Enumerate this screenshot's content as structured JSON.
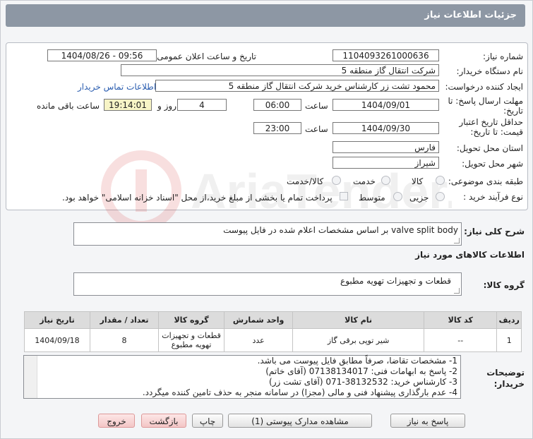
{
  "header": {
    "title": "جزئیات اطلاعات نیاز"
  },
  "form": {
    "need_number_label": "شماره نیاز:",
    "need_number": "1104093261000636",
    "announce_label": "تاریخ و ساعت اعلان عمومی:",
    "announce_value": "1404/08/26 - 09:56",
    "buyer_org_label": "نام دستگاه خریدار:",
    "buyer_org": "شرکت انتقال گاز منطقه 5",
    "creator_label": "ایجاد کننده درخواست:",
    "creator": "محمود تشت زر کارشناس خرید شرکت انتقال گاز منطقه 5",
    "contact_link": "اطلاعات تماس خریدار",
    "deadline_label": "مهلت ارسال پاسخ: تا تاریخ:",
    "deadline_date": "1404/09/01",
    "time_label": "ساعت",
    "deadline_time": "06:00",
    "days_value": "4",
    "days_label": "روز و",
    "remaining_time": "19:14:01",
    "remaining_label": "ساعت باقی مانده",
    "validity_label": "حداقل تاریخ اعتبار قیمت: تا تاریخ:",
    "validity_date": "1404/09/30",
    "validity_time": "23:00",
    "province_label": "استان محل تحویل:",
    "province": "فارس",
    "city_label": "شهر محل تحویل:",
    "city": "شیراز",
    "category_label": "طبقه بندی موضوعی:",
    "category_options": [
      "کالا",
      "خدمت",
      "کالا/خدمت"
    ],
    "process_label": "نوع فرآیند خرید :",
    "process_options": [
      "جزیی",
      "متوسط"
    ],
    "payment_note": "پرداخت تمام یا بخشی از مبلغ خرید،از محل \"اسناد خزانه اسلامی\" خواهد بود."
  },
  "description": {
    "label": "شرح کلی نیاز:",
    "value": "valve split body بر اساس مشخصات اعلام شده در فایل پیوست"
  },
  "goods_info": {
    "section_title": "اطلاعات کالاهای مورد نیاز",
    "group_label": "گروه کالا:",
    "group_value": "قطعات و تجهیزات تهویه مطبوع"
  },
  "table": {
    "headers": [
      "ردیف",
      "کد کالا",
      "نام کالا",
      "واحد شمارش",
      "گروه کالا",
      "تعداد / مقدار",
      "تاریخ نیاز"
    ],
    "rows": [
      {
        "row": "1",
        "code": "--",
        "name": "شیر توپی برقی گاز",
        "unit": "عدد",
        "group": "قطعات و تجهیزات تهویه مطبوع",
        "qty": "8",
        "date": "1404/09/18"
      }
    ]
  },
  "buyer_notes": {
    "label": "توضیحات خریدار:",
    "lines": [
      "1-  مشخصات تقاضا، صرفاً مطابق فایل پیوست می باشد.",
      "2- پاسخ به ابهامات فنی: 07138134017 (آقای خاتم)",
      "3- کارشناس خرید: 38132532-071 (آقای تشت زر)",
      "4- عدم بارگذاری پیشنهاد فنی و مالی (مجزا) در سامانه منجر به حذف تامین کننده میگردد."
    ]
  },
  "buttons": {
    "reply": "پاسخ به نیاز",
    "attachments": "مشاهده مدارک پیوستی (1)",
    "print": "چاپ",
    "back": "بازگشت",
    "exit": "خروج"
  },
  "colors": {
    "titlebar": "#8d97a4",
    "link": "#2a5db0",
    "remaining_bg": "#f7f4c6"
  }
}
